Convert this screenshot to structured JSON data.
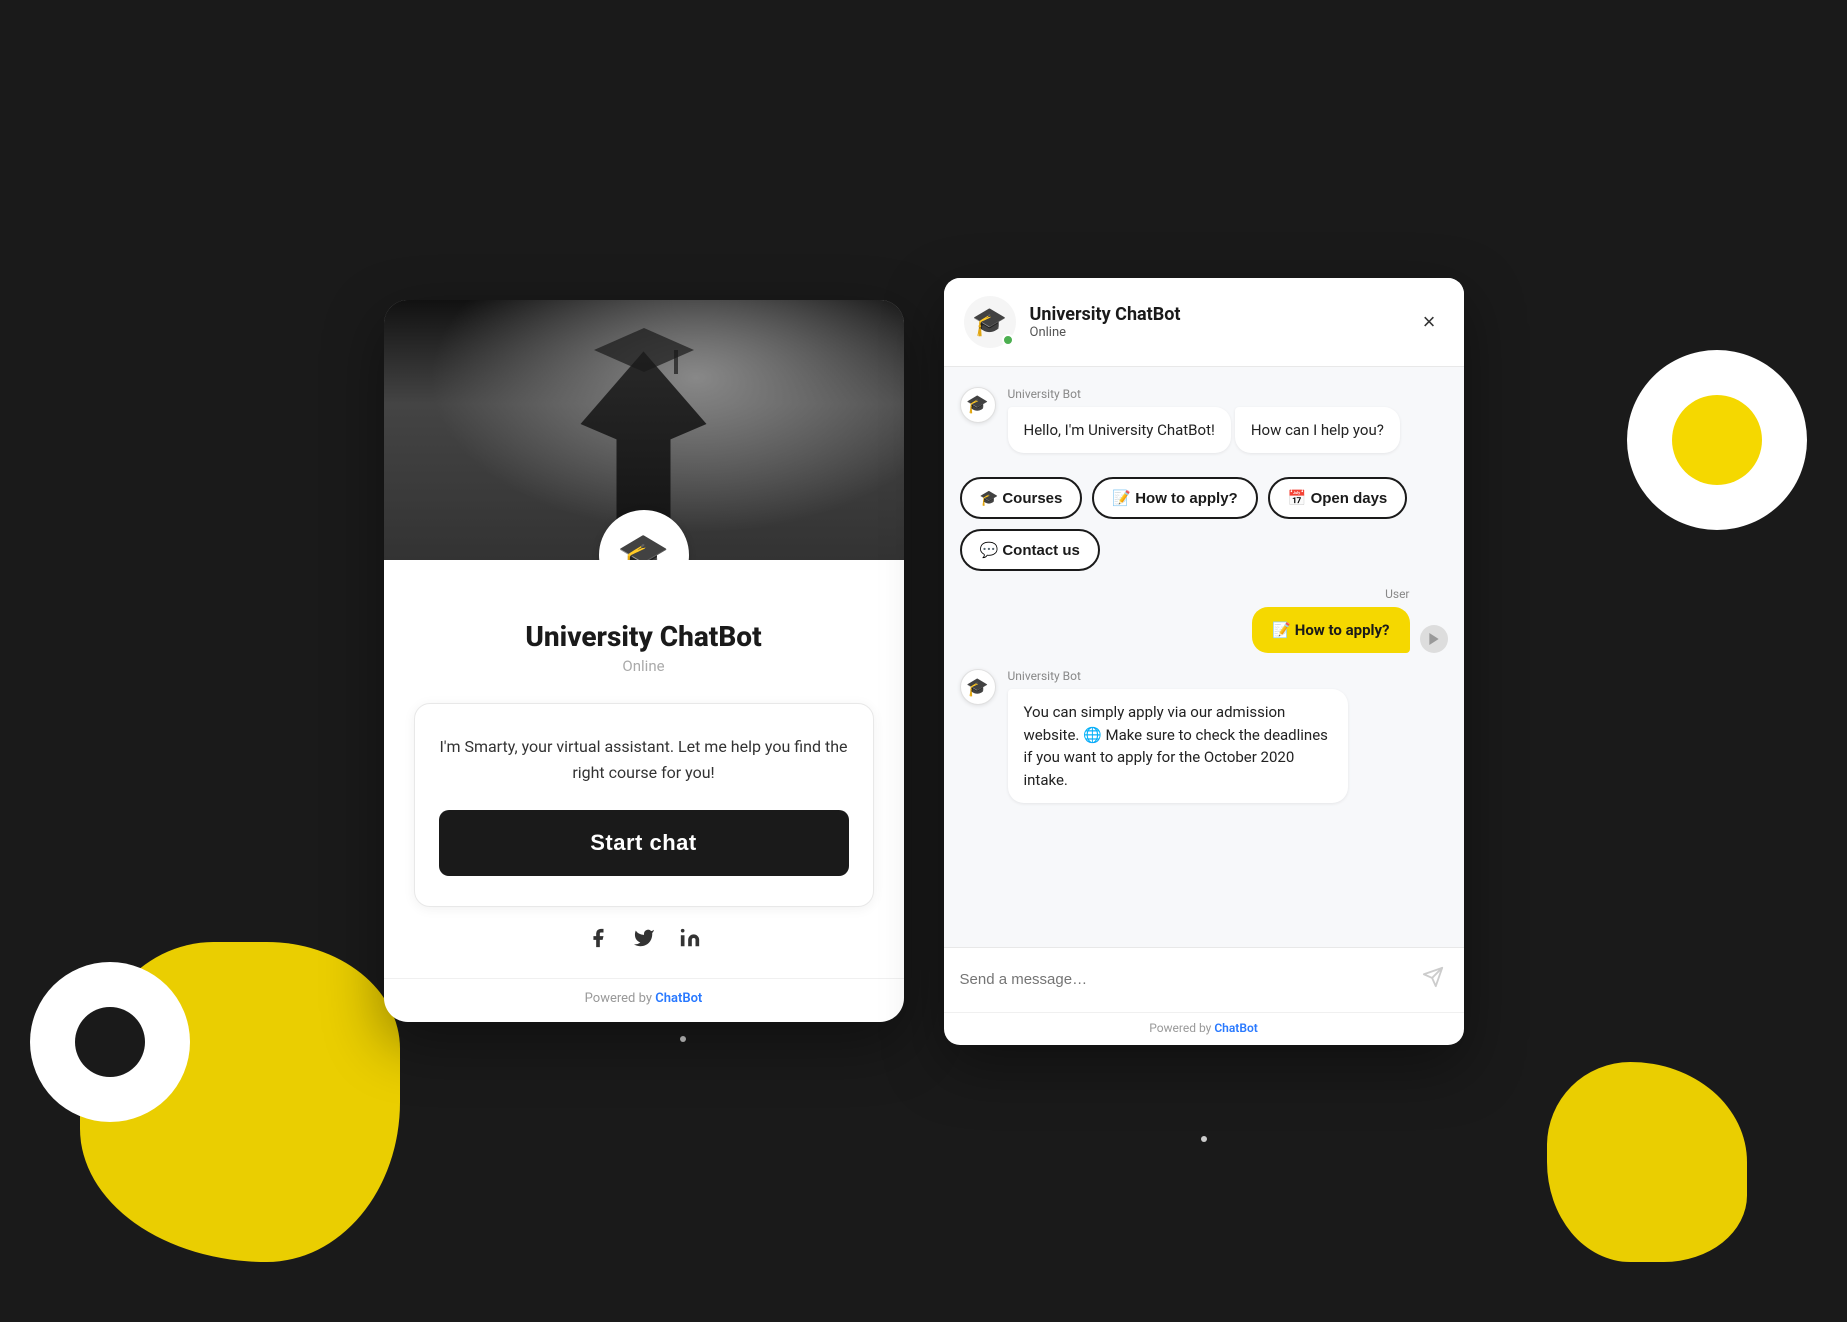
{
  "background": {
    "color": "#1a1a1a"
  },
  "left_card": {
    "title": "University ChatBot",
    "status": "Online",
    "intro_text": "I'm Smarty, your virtual assistant. Let me help you find the right course for you!",
    "start_chat_label": "Start chat",
    "powered_label": "Powered by ",
    "powered_link": "ChatBot",
    "social": [
      "facebook",
      "twitter",
      "linkedin"
    ]
  },
  "right_chat": {
    "header": {
      "name": "University ChatBot",
      "status": "Online",
      "close_label": "×"
    },
    "messages": [
      {
        "type": "bot",
        "sender": "University Bot",
        "bubbles": [
          "Hello, I'm University ChatBot!",
          "How can I help you?"
        ],
        "quick_replies": [
          {
            "icon": "🎓",
            "label": "Courses"
          },
          {
            "icon": "📝",
            "label": "How to apply?"
          },
          {
            "icon": "📅",
            "label": "Open days"
          },
          {
            "icon": "💬",
            "label": "Contact us"
          }
        ]
      },
      {
        "type": "user",
        "sender": "User",
        "bubble": "📝 How to apply?"
      },
      {
        "type": "bot",
        "sender": "University Bot",
        "bubbles": [
          "You can simply apply via our admission website. 🌐 Make sure to check the deadlines if you want to apply for the October 2020 intake."
        ],
        "quick_replies": []
      }
    ],
    "input_placeholder": "Send a message…",
    "powered_label": "Powered by ",
    "powered_link": "ChatBot"
  }
}
